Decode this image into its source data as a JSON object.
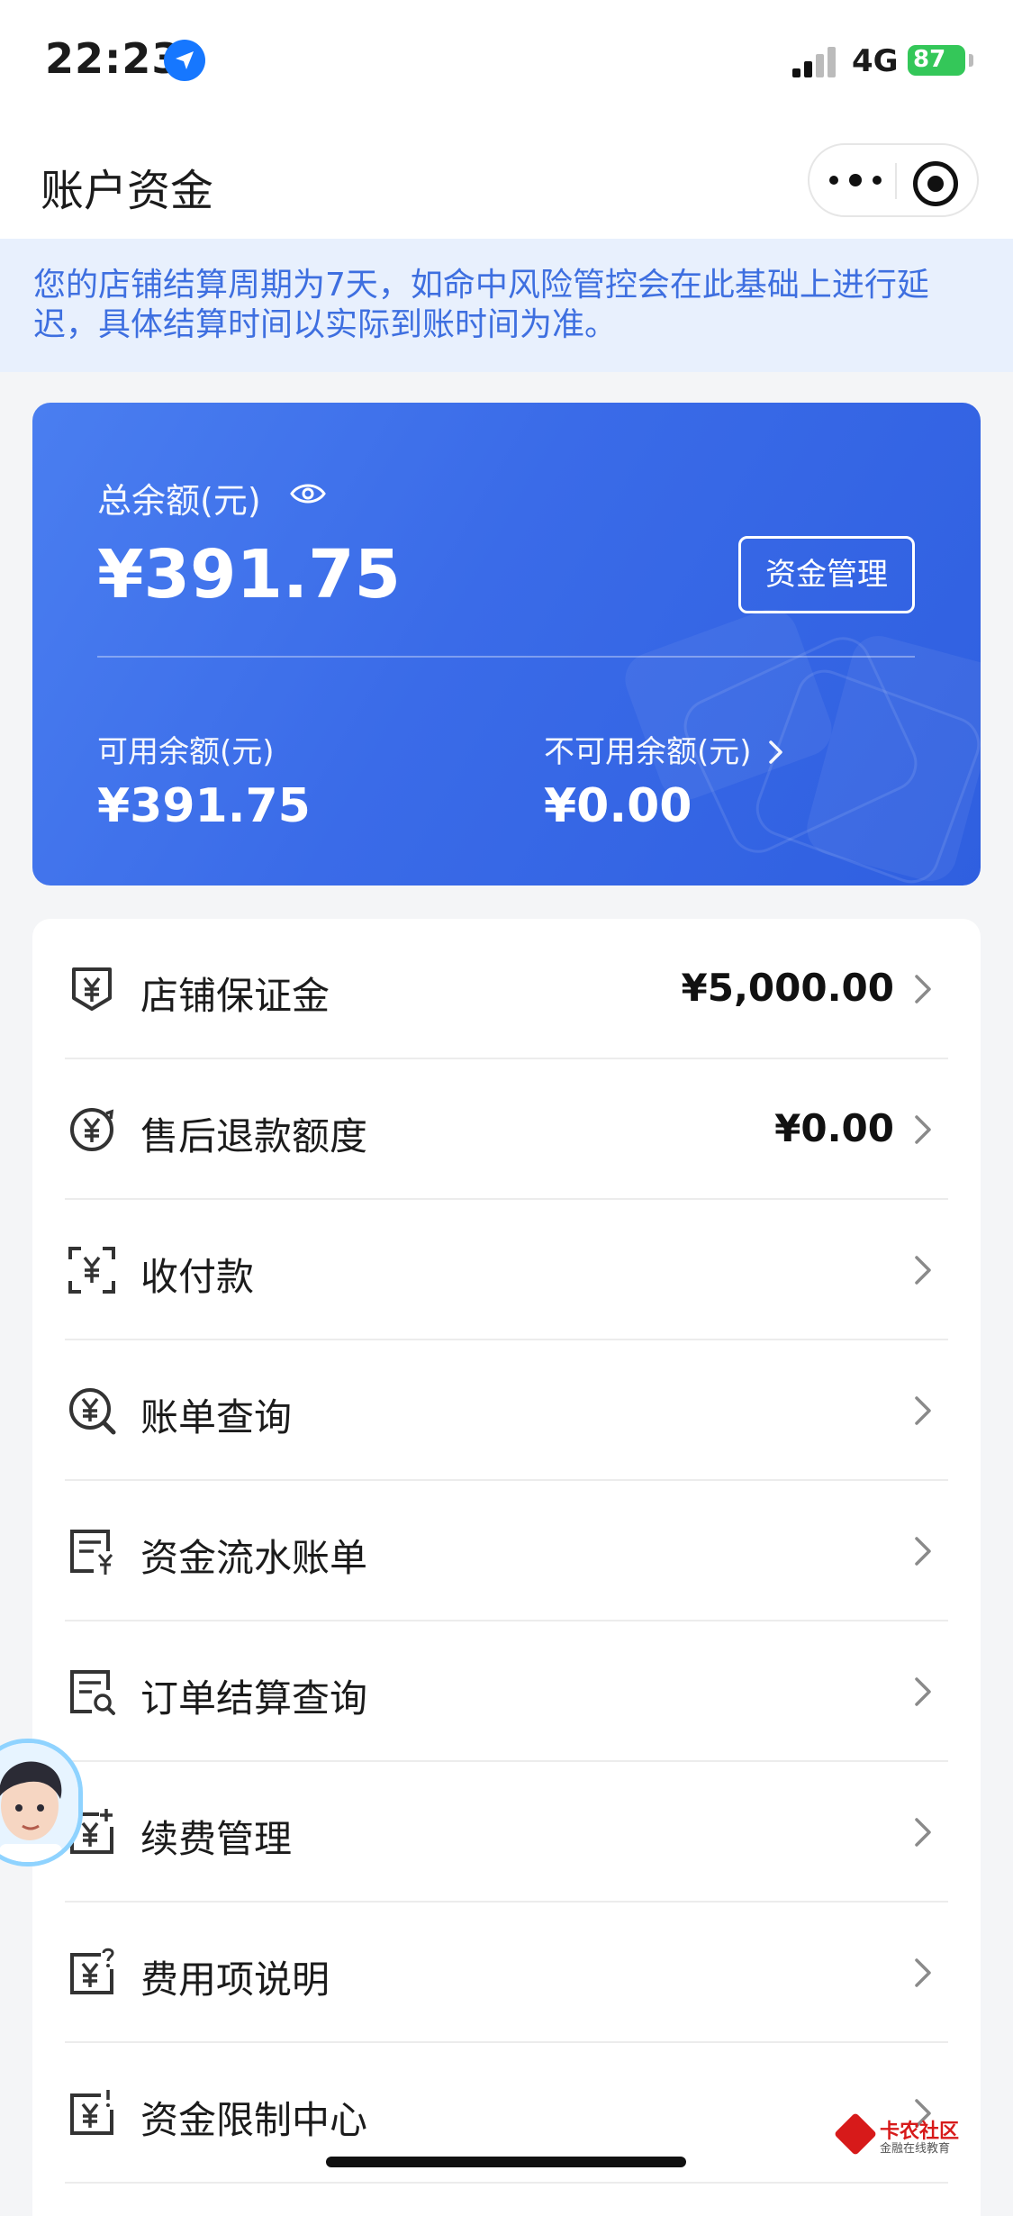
{
  "status_bar": {
    "time": "22:23",
    "network": "4G",
    "battery": "87"
  },
  "nav": {
    "title": "账户资金"
  },
  "notice": {
    "text": "您的店铺结算周期为7天，如命中风险管控会在此基础上进行延迟，具体结算时间以实际到账时间为准。"
  },
  "balance": {
    "total_label": "总余额(元)",
    "total_value": "¥391.75",
    "manage_button": "资金管理",
    "available_label": "可用余额(元)",
    "available_value": "¥391.75",
    "unavailable_label": "不可用余额(元)",
    "unavailable_value": "¥0.00"
  },
  "menu": [
    {
      "label": "店铺保证金",
      "value": "¥5,000.00",
      "icon": "deposit-icon"
    },
    {
      "label": "售后退款额度",
      "value": "¥0.00",
      "icon": "refund-icon"
    },
    {
      "label": "收付款",
      "value": "",
      "icon": "scan-pay-icon"
    },
    {
      "label": "账单查询",
      "value": "",
      "icon": "bill-search-icon"
    },
    {
      "label": "资金流水账单",
      "value": "",
      "icon": "flow-bill-icon"
    },
    {
      "label": "订单结算查询",
      "value": "",
      "icon": "order-settle-icon"
    },
    {
      "label": "续费管理",
      "value": "",
      "icon": "renewal-icon"
    },
    {
      "label": "费用项说明",
      "value": "",
      "icon": "fee-help-icon"
    },
    {
      "label": "资金限制中心",
      "value": "",
      "icon": "fund-limit-icon"
    }
  ],
  "watermark": {
    "title": "卡农社区",
    "subtitle": "金融在线教育"
  },
  "colors": {
    "accent": "#3a6be8",
    "notice_text": "#3e6fe0",
    "notice_bg": "#e8f0fd"
  }
}
